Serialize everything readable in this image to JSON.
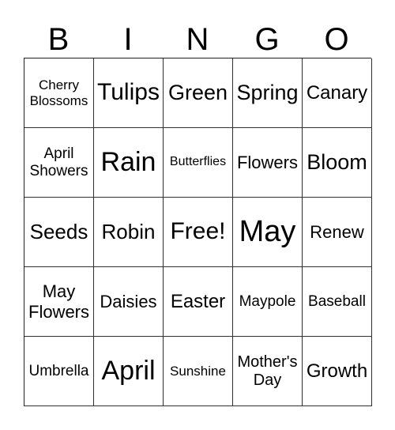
{
  "header": {
    "letters": [
      "B",
      "I",
      "N",
      "G",
      "O"
    ]
  },
  "cells": [
    [
      "Cherry Blossoms",
      "Tulips",
      "Green",
      "Spring",
      "Canary"
    ],
    [
      "April Showers",
      "Rain",
      "Butterflies",
      "Flowers",
      "Bloom"
    ],
    [
      "Seeds",
      "Robin",
      "Free!",
      "May",
      "Renew"
    ],
    [
      "May Flowers",
      "Daisies",
      "Easter",
      "Maypole",
      "Baseball"
    ],
    [
      "Umbrella",
      "April",
      "Sunshine",
      "Mother's Day",
      "Growth"
    ]
  ]
}
